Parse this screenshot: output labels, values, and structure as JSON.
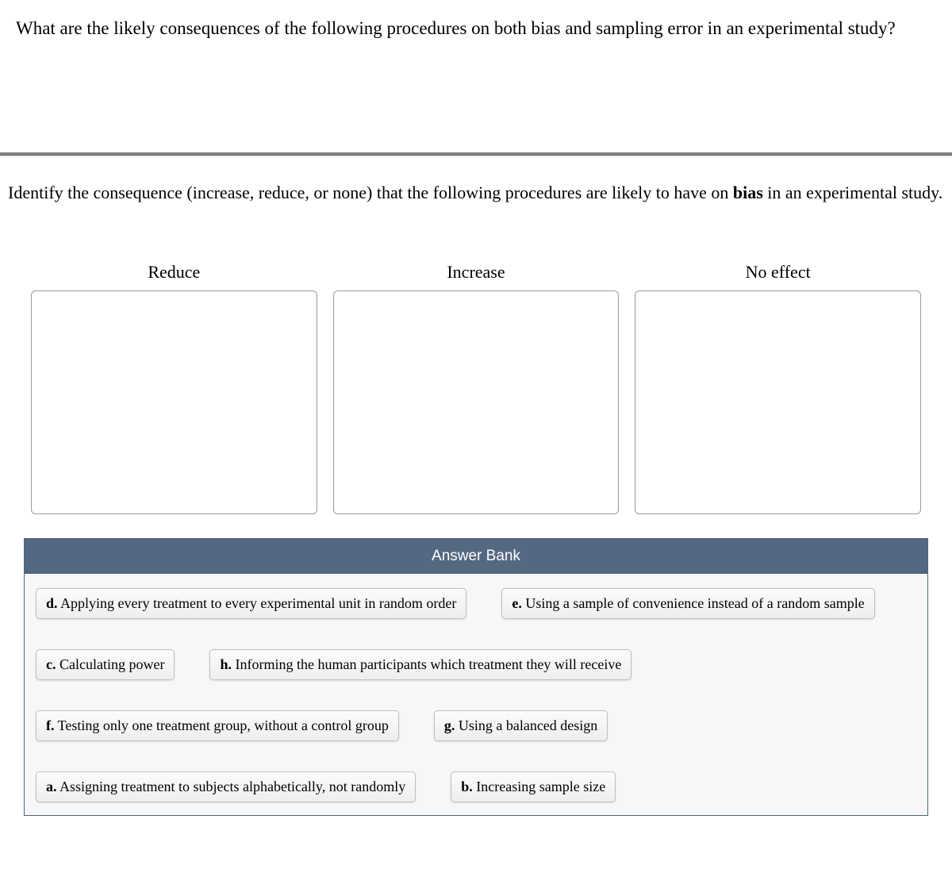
{
  "top_question": "What are the likely consequences of the following procedures on both bias and sampling error in an experimental study?",
  "sub_question_pre": "Identify the consequence (increase, reduce, or none) that the following procedures are likely to have on ",
  "sub_question_bold": "bias",
  "sub_question_post": " in an experimental study.",
  "drop_zones": {
    "reduce": "Reduce",
    "increase": "Increase",
    "no_effect": "No effect"
  },
  "answer_bank": {
    "title": "Answer Bank",
    "rows": [
      [
        {
          "letter": "d.",
          "text": " Applying every treatment to every experimental unit in random order"
        },
        {
          "letter": "e.",
          "text": " Using a sample of convenience instead of a random sample"
        }
      ],
      [
        {
          "letter": "c.",
          "text": " Calculating power"
        },
        {
          "letter": "h.",
          "text": " Informing the human participants which treatment they will receive"
        }
      ],
      [
        {
          "letter": "f.",
          "text": " Testing only one treatment group, without a control group"
        },
        {
          "letter": "g.",
          "text": " Using a balanced design"
        }
      ],
      [
        {
          "letter": "a.",
          "text": " Assigning treatment to subjects alphabetically, not randomly"
        },
        {
          "letter": "b.",
          "text": " Increasing sample size"
        }
      ]
    ]
  }
}
